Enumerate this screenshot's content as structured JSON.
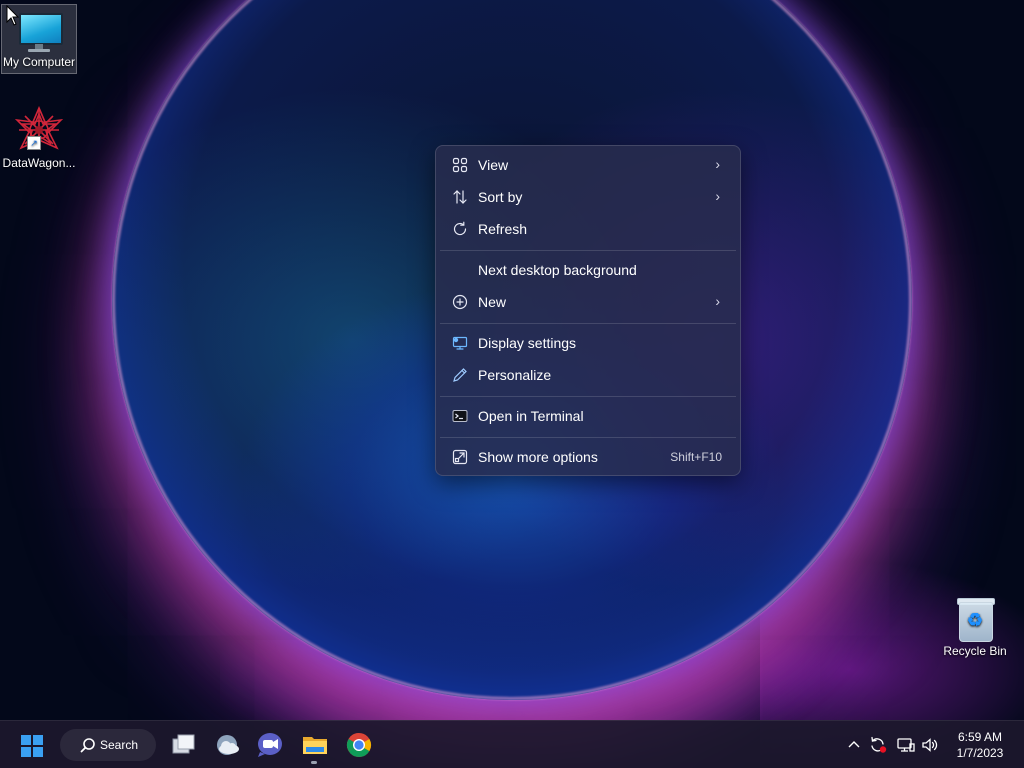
{
  "desktop": {
    "icons": [
      {
        "label": "My Computer",
        "icon": "monitor-icon",
        "selected": true
      },
      {
        "label": "DataWagon...",
        "icon": "datawagon-app-icon",
        "shortcut": true
      },
      {
        "label": "Recycle Bin",
        "icon": "recycle-bin-icon"
      }
    ]
  },
  "context_menu": {
    "items": [
      {
        "label": "View",
        "icon": "grid-view-icon",
        "submenu": true
      },
      {
        "label": "Sort by",
        "icon": "sort-icon",
        "submenu": true
      },
      {
        "label": "Refresh",
        "icon": "refresh-icon"
      },
      {
        "label": "Next desktop background",
        "icon": ""
      },
      {
        "label": "New",
        "icon": "plus-circle-icon",
        "submenu": true
      },
      {
        "label": "Display settings",
        "icon": "display-settings-icon"
      },
      {
        "label": "Personalize",
        "icon": "pen-icon"
      },
      {
        "label": "Open in Terminal",
        "icon": "terminal-icon"
      },
      {
        "label": "Show more options",
        "icon": "expand-icon",
        "shortcut": "Shift+F10"
      }
    ]
  },
  "taskbar": {
    "search_label": "Search",
    "apps": [
      "task-view-icon",
      "weather-widget-icon",
      "teams-chat-icon",
      "file-explorer-icon",
      "chrome-icon"
    ],
    "tray": [
      "chevron-up-icon",
      "sync-alert-icon",
      "network-icon",
      "volume-icon"
    ],
    "clock": {
      "time": "6:59 AM",
      "date": "1/7/2023"
    }
  },
  "colors": {
    "menu_bg": "#2c2f55",
    "accent": "#3aa0f2",
    "taskbar_bg": "#1c182c"
  }
}
